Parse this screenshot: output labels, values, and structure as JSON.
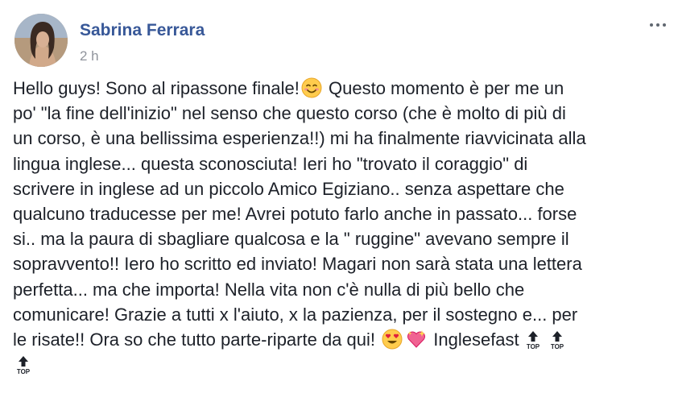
{
  "post": {
    "author": "Sabrina Ferrara",
    "timestamp": "2 h",
    "lines": [
      "Hello guys! Sono al ripassone finale!",
      " Questo momento è per me un",
      "po' \"la fine dell'inizio\" nel senso che questo corso (che è molto di più di",
      "un corso, è una bellissima esperienza!!) mi ha finalmente riavvicinata alla",
      "lingua inglese... questa sconosciuta! Ieri ho \"trovato il coraggio\" di",
      "scrivere in inglese ad un piccolo Amico Egiziano.. senza aspettare che",
      "qualcuno traducesse per me! Avrei potuto farlo anche in passato... forse",
      "si.. ma la paura di sbagliare qualcosa e la \" ruggine\" avevano sempre il",
      "sopravvento!! Iero ho scritto ed inviato! Magari non sarà stata una lettera",
      "perfetta... ma che importa! Nella vita non c'è nulla di più bello che",
      "comunicare! Grazie a tutti x l'aiuto, x la pazienza, per il sostegno e... per",
      "le risate!! Ora so che tutto parte-riparte da qui!",
      " Inglesefast"
    ],
    "emoji": {
      "smile": "smiling-face-emoji",
      "heart_eyes": "heart-eyes-emoji",
      "sparkling_heart": "sparkling-heart-emoji",
      "top_arrow": "top-arrow-emoji",
      "top_label": "TOP"
    }
  }
}
